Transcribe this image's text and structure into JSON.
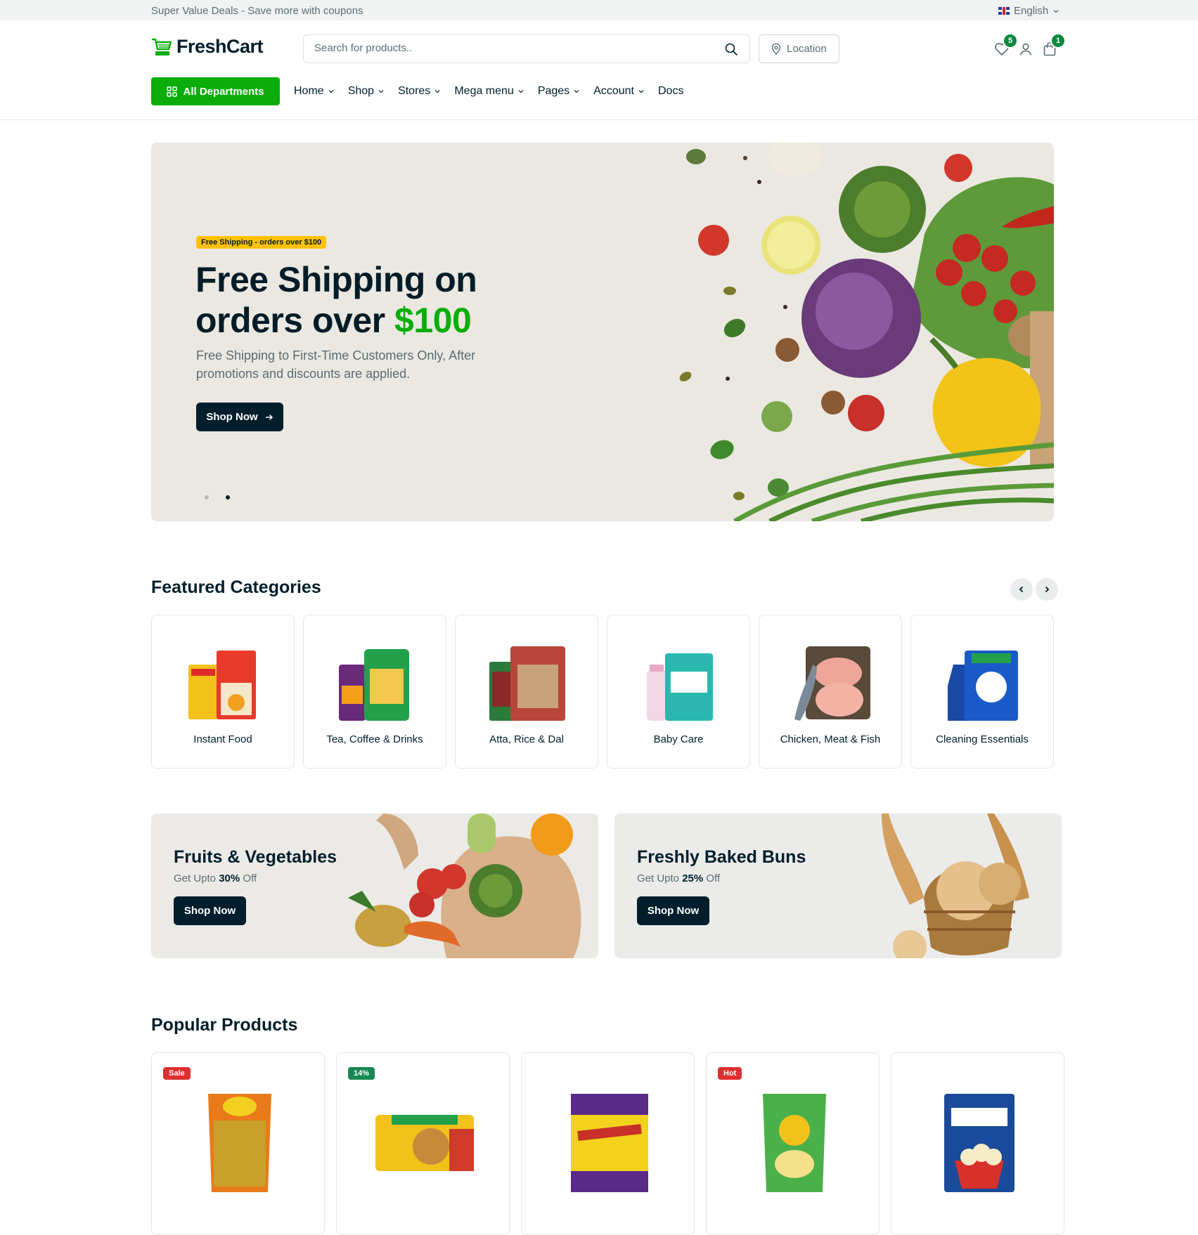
{
  "topbar": {
    "deal_text": "Super Value Deals - Save more with coupons",
    "language": "English"
  },
  "header": {
    "logo_text": "FreshCart",
    "search": {
      "placeholder": "Search for products.."
    },
    "location_label": "Location",
    "wishlist_count": "5",
    "cart_count": "1"
  },
  "nav": {
    "all_departments": "All Departments",
    "items": [
      {
        "label": "Home"
      },
      {
        "label": "Shop"
      },
      {
        "label": "Stores"
      },
      {
        "label": "Mega menu"
      },
      {
        "label": "Pages"
      },
      {
        "label": "Account"
      },
      {
        "label": "Docs"
      }
    ]
  },
  "hero": {
    "badge": "Free Shipping - orders over $100",
    "title_part1": "Free Shipping on orders over ",
    "title_accent": "$100",
    "subtitle": "Free Shipping to First-Time Customers Only, After promotions and discounts are applied.",
    "button": "Shop Now",
    "slides": 2,
    "active_slide": 2
  },
  "featured": {
    "title": "Featured Categories",
    "categories": [
      {
        "label": "Instant Food"
      },
      {
        "label": "Tea, Coffee & Drinks"
      },
      {
        "label": "Atta, Rice & Dal"
      },
      {
        "label": "Baby Care"
      },
      {
        "label": "Chicken, Meat & Fish"
      },
      {
        "label": "Cleaning Essentials"
      }
    ]
  },
  "promos": [
    {
      "title": "Fruits & Vegetables",
      "sub_prefix": "Get Upto ",
      "sub_value": "30%",
      "sub_suffix": " Off",
      "button": "Shop Now"
    },
    {
      "title": "Freshly Baked Buns",
      "sub_prefix": "Get Upto ",
      "sub_value": "25%",
      "sub_suffix": " Off",
      "button": "Shop Now"
    }
  ],
  "popular": {
    "title": "Popular Products",
    "products": [
      {
        "badge": "Sale",
        "badge_color": "#db3030"
      },
      {
        "badge": "14%",
        "badge_color": "#198754"
      },
      {
        "badge": "",
        "badge_color": ""
      },
      {
        "badge": "Hot",
        "badge_color": "#db3030"
      },
      {
        "badge": "",
        "badge_color": ""
      }
    ]
  },
  "colors": {
    "brand_green": "#0aad0a",
    "dark": "#001e2b",
    "muted": "#5c6c75",
    "badge_yellow": "#ffc107"
  }
}
